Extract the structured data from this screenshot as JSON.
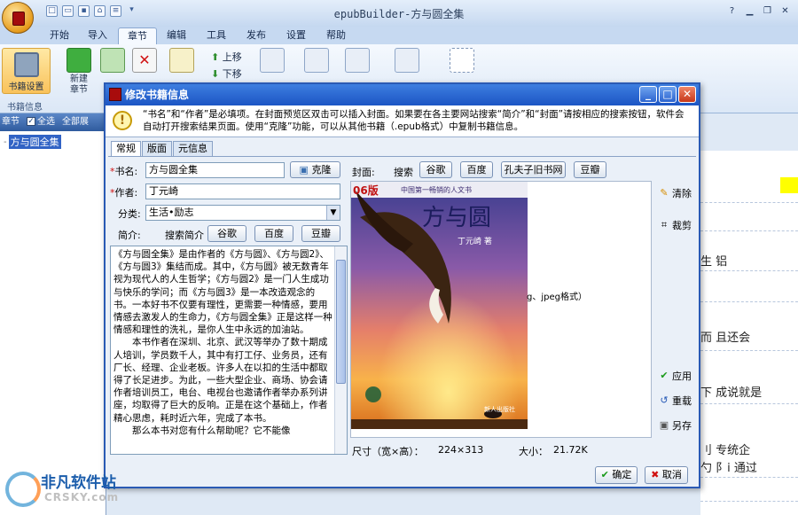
{
  "app": {
    "title": "epubBuilder-方与圆全集",
    "tabs": [
      "开始",
      "导入",
      "章节",
      "编辑",
      "工具",
      "发布",
      "设置",
      "帮助"
    ],
    "active_tab": "章节"
  },
  "ribbon": {
    "book_settings": "书籍设置",
    "group_label": "书籍信息",
    "new_chapter": "新建\n章节",
    "up": "上移",
    "down": "下移"
  },
  "left_panel": {
    "header_chapter": "章节",
    "select_all": "全选",
    "expand_all": "全部展",
    "tree_item": "方与圆全集"
  },
  "editor": {
    "lines": [
      "生 铝",
      "而 且还会",
      "下 成说就是",
      "刂  专统企",
      "勺 阝i 通过"
    ]
  },
  "dialog": {
    "title": "修改书籍信息",
    "info": "“书名”和“作者”是必填项。在封面预览区双击可以插入封面。如果要在各主要网站搜索“简介”和“封面”请按相应的搜索按钮，软件会自动打开搜索结果页面。使用“克隆”功能，可以从其他书籍（.epub格式）中复制书籍信息。",
    "tabs": [
      "常规",
      "版面",
      "元信息"
    ],
    "active_tab": "常规",
    "fields": {
      "title_label": "书名:",
      "title_value": "方与圆全集",
      "author_label": "作者:",
      "author_value": "丁元崎",
      "category_label": "分类:",
      "category_value": "生活•励志",
      "intro_label": "简介:",
      "search_intro_label": "搜索简介",
      "clone_button": "克隆"
    },
    "search_buttons": [
      "谷歌",
      "百度",
      "豆瓣"
    ],
    "intro_text": "《方与圆全集》是由作者的《方与圆》、《方与圆2》、《方与圆3》集结而成。其中，《方与圆》被无数青年视为现代人的人生哲学；《方与圆2》是一门人生成功与快乐的学问；而《方与圆3》是一本改造观念的书。一本好书不仅要有理性，更需要一种情感，要用情感去激发人的生命力，《方与圆全集》正是这样一种情感和理性的洗礼，是你人生中永远的加油站。\n　　本书作者在深圳、北京、武汉等举办了数十期成人培训，学员数千人，其中有打工仔、业务员，还有厂长、经理、企业老板。许多人在以扣的生活中都取得了长足进步。为此，一些大型企业、商场、协会请作者培训员工，电台、电视台也邀请作者举办系列讲座，均取得了巨大的反响。正是在这个基础上，作者精心思虑，耗时近六年，完成了本书。\n　　那么本书对您有什么帮助呢？它不能像",
    "cover": {
      "label": "封面:",
      "search_label": "搜索",
      "search_buttons": [
        "谷歌",
        "百度",
        "孔夫子旧书网",
        "豆瓣"
      ],
      "hint": "g、jpeg格式）",
      "size_label": "尺寸（宽×高）：",
      "size_value": "224×313",
      "filesize_label": "大小：",
      "filesize_value": "21.72K",
      "book_edition": "06版",
      "book_tagline": "中国第一畅销的人文书",
      "book_title": "方与圆",
      "book_author": "丁元崎 著",
      "book_publisher": "新人出版社"
    },
    "side_tools": {
      "clear": "清除",
      "crop": "裁剪",
      "apply": "应用",
      "reload": "重载",
      "save_as": "另存"
    },
    "ok": "确定",
    "cancel": "取消"
  },
  "watermark": {
    "name": "非凡软件站",
    "url": "CRSKY.com"
  }
}
